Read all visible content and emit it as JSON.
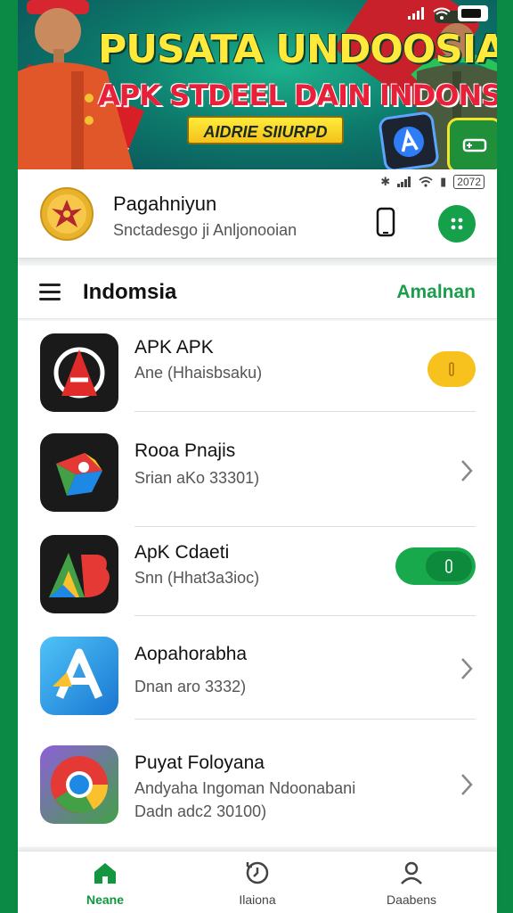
{
  "banner": {
    "title": "PUSATA UNDOOSIA",
    "subtitle": "APK STDEEL DAIN INDONSIA",
    "badge": "AIDRIE SIIURPD",
    "status_time": "",
    "colors": {
      "title": "#ffe93a",
      "subtitle": "#e8203a",
      "badge": "#f7c21e"
    }
  },
  "account": {
    "name": "Pagahniyun",
    "subtitle": "Snctadesgo ji Anljonooian",
    "status_text": "2072",
    "menu_icon": "dots-grid-icon",
    "device_icon": "phone-icon"
  },
  "section": {
    "title": "Indomsia",
    "action": "Amalnan"
  },
  "list": {
    "items": [
      {
        "title": "APK APK",
        "subtitle": "Ane (Hhaisbsaku)",
        "control": "pill",
        "icon": "red-a-logo-icon"
      },
      {
        "title": "Rooa Pnajis",
        "subtitle": "Srian aKo 33301)",
        "control": "chevron",
        "icon": "google-arrow-icon"
      },
      {
        "title": "ApK Cdaeti",
        "subtitle": "Snn (Hhat3a3ioc)",
        "control": "toggle",
        "icon": "ab-letters-icon"
      },
      {
        "title": "Aopahorabha",
        "subtitle": "Dnan aro 3332)",
        "control": "chevron",
        "icon": "blue-a-store-icon"
      },
      {
        "title": "Puyat Foloyana",
        "subtitle": "Andyaha Ingoman Ndoonabani",
        "subtitle2": "Dadn adc2 30100)",
        "control": "chevron",
        "icon": "chrome-icon"
      }
    ]
  },
  "bottom_nav": {
    "items": [
      {
        "label": "Neane",
        "icon": "home-icon",
        "active": true
      },
      {
        "label": "Ilaiona",
        "icon": "history-icon",
        "active": false
      },
      {
        "label": "Daabens",
        "icon": "user-icon",
        "active": false
      }
    ]
  },
  "accent_color": "#15a04a"
}
